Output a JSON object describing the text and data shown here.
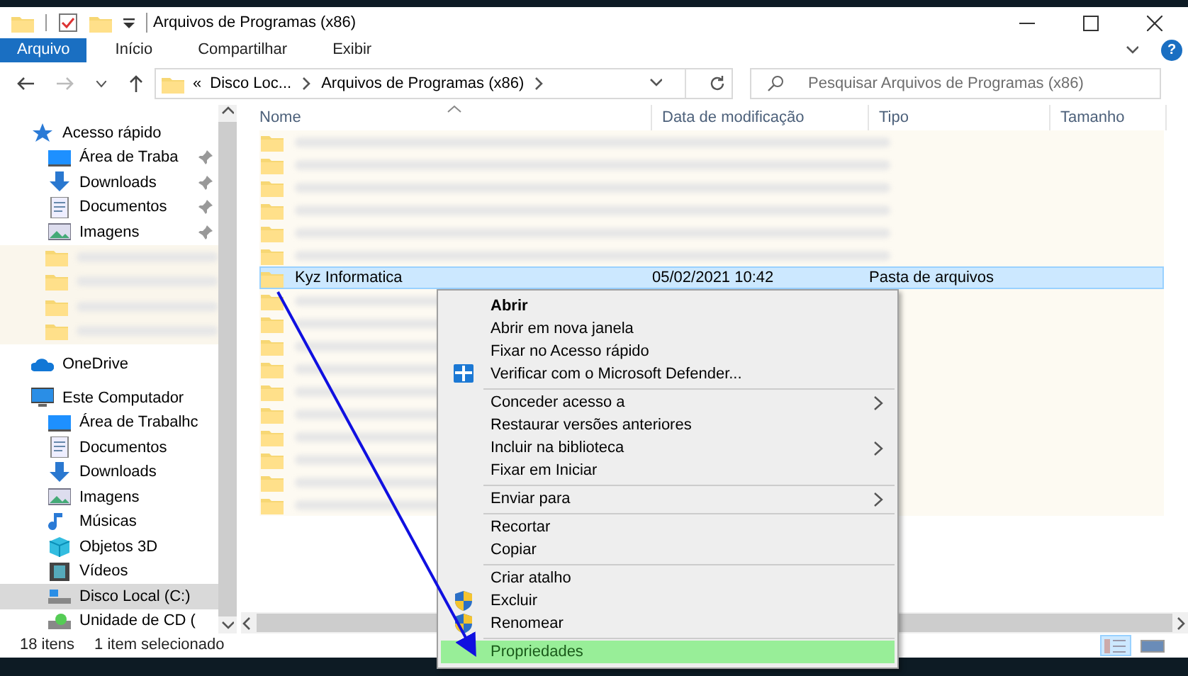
{
  "window": {
    "title": "Arquivos de Programas (x86)"
  },
  "ribbon": {
    "tabs": [
      {
        "label": "Arquivo",
        "selected": true
      },
      {
        "label": "Início",
        "selected": false
      },
      {
        "label": "Compartilhar",
        "selected": false
      },
      {
        "label": "Exibir",
        "selected": false
      }
    ],
    "help_button": "?"
  },
  "address_bar": {
    "overflow": "«",
    "crumbs": [
      "Disco Loc...",
      "Arquivos de Programas (x86)"
    ]
  },
  "search": {
    "placeholder": "Pesquisar Arquivos de Programas (x86)"
  },
  "sidebar": {
    "items": [
      {
        "kind": "quick-access",
        "label": "Acesso rápido",
        "selected": false,
        "children": [
          {
            "kind": "desktop",
            "label": "Área de Traba",
            "pinned": true,
            "selected": false
          },
          {
            "kind": "downloads",
            "label": "Downloads",
            "pinned": true,
            "selected": false
          },
          {
            "kind": "documents",
            "label": "Documentos",
            "pinned": true,
            "selected": false
          },
          {
            "kind": "pictures",
            "label": "Imagens",
            "pinned": true,
            "selected": false
          },
          {
            "kind": "blurred"
          },
          {
            "kind": "blurred"
          },
          {
            "kind": "blurred"
          },
          {
            "kind": "blurred"
          }
        ]
      },
      {
        "kind": "onedrive",
        "label": "OneDrive",
        "selected": false
      },
      {
        "kind": "computer",
        "label": "Este Computador",
        "selected": false,
        "children": [
          {
            "kind": "desktop",
            "label": "Área de Trabalhc",
            "selected": false
          },
          {
            "kind": "documents",
            "label": "Documentos",
            "selected": false
          },
          {
            "kind": "downloads",
            "label": "Downloads",
            "selected": false
          },
          {
            "kind": "pictures",
            "label": "Imagens",
            "selected": false
          },
          {
            "kind": "music",
            "label": "Músicas",
            "selected": false
          },
          {
            "kind": "objects3d",
            "label": "Objetos 3D",
            "selected": false
          },
          {
            "kind": "videos",
            "label": "Vídeos",
            "selected": false
          },
          {
            "kind": "drive",
            "label": "Disco Local (C:)",
            "selected": true
          },
          {
            "kind": "cd",
            "label": "Unidade de CD (",
            "selected": false
          }
        ]
      }
    ]
  },
  "table": {
    "columns": [
      "Nome",
      "Data de modificação",
      "Tipo",
      "Tamanho"
    ],
    "rows": [
      {
        "kind": "blurred"
      },
      {
        "kind": "blurred"
      },
      {
        "kind": "blurred"
      },
      {
        "kind": "blurred"
      },
      {
        "kind": "blurred"
      },
      {
        "kind": "blurred"
      },
      {
        "kind": "folder",
        "name": "Kyz Informatica",
        "modified": "05/02/2021 10:42",
        "type": "Pasta de arquivos",
        "selected": true
      },
      {
        "kind": "blurred"
      },
      {
        "kind": "blurred"
      },
      {
        "kind": "blurred"
      },
      {
        "kind": "blurred"
      },
      {
        "kind": "blurred"
      },
      {
        "kind": "blurred"
      },
      {
        "kind": "blurred"
      },
      {
        "kind": "blurred"
      },
      {
        "kind": "blurred"
      },
      {
        "kind": "blurred"
      }
    ]
  },
  "context_menu": {
    "items": [
      {
        "kind": "item",
        "label": "Abrir",
        "bold": true,
        "selected": false
      },
      {
        "kind": "item",
        "label": "Abrir em nova janela",
        "selected": false
      },
      {
        "kind": "item",
        "label": "Fixar no Acesso rápido",
        "selected": false
      },
      {
        "kind": "defender-item",
        "label": "Verificar com o Microsoft Defender...",
        "selected": false
      },
      {
        "kind": "separator"
      },
      {
        "kind": "item",
        "label": "Conceder acesso a",
        "submenu": true,
        "selected": false
      },
      {
        "kind": "item",
        "label": "Restaurar versões anteriores",
        "selected": false
      },
      {
        "kind": "item",
        "label": "Incluir na biblioteca",
        "submenu": true,
        "selected": false
      },
      {
        "kind": "item",
        "label": "Fixar em Iniciar",
        "selected": false
      },
      {
        "kind": "separator"
      },
      {
        "kind": "item",
        "label": "Enviar para",
        "submenu": true,
        "selected": false
      },
      {
        "kind": "separator"
      },
      {
        "kind": "item",
        "label": "Recortar",
        "selected": false
      },
      {
        "kind": "item",
        "label": "Copiar",
        "selected": false
      },
      {
        "kind": "separator"
      },
      {
        "kind": "item",
        "label": "Criar atalho",
        "selected": false
      },
      {
        "kind": "shield-item",
        "label": "Excluir",
        "selected": false
      },
      {
        "kind": "shield-item",
        "label": "Renomear",
        "selected": false
      },
      {
        "kind": "separator"
      },
      {
        "kind": "item",
        "label": "Propriedades",
        "selected": true
      }
    ]
  },
  "status_bar": {
    "count": "18 itens",
    "selection": "1 item selecionado",
    "views": [
      {
        "kind": "details",
        "selected": true
      },
      {
        "kind": "tiles",
        "selected": false
      }
    ]
  }
}
